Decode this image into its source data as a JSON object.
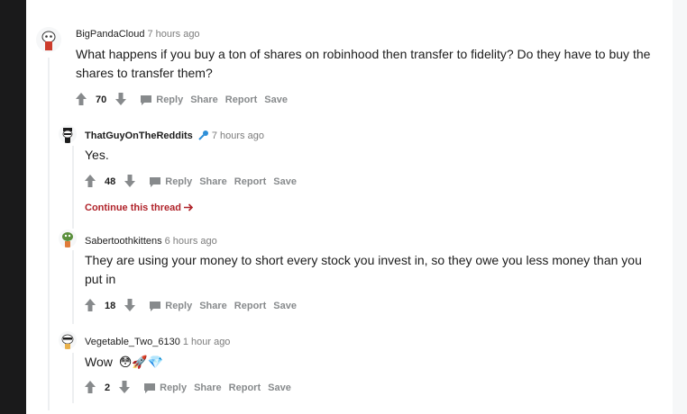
{
  "comments": [
    {
      "username": "BigPandaCloud",
      "time": "7 hours ago",
      "text": "What happens if you buy a ton of shares on robinhood then transfer to fidelity? Do they have to buy the shares to transfer them?",
      "score": "70",
      "avatar_color": "#cc3b2b"
    },
    {
      "username": "ThatGuyOnTheReddits",
      "time": "7 hours ago",
      "text": "Yes.",
      "score": "48",
      "flair_icon": "microphone-icon",
      "avatar_color": "#1c1c1c"
    },
    {
      "username": "Sabertoothkittens",
      "time": "6 hours ago",
      "text": "They are using your money to short every stock you invest in, so they owe you less money than you put in",
      "score": "18",
      "avatar_color": "#5a8f3c"
    },
    {
      "username": "Vegetable_Two_6130",
      "time": "1 hour ago",
      "text": "Wow",
      "emojis": "😳🚀💎",
      "score": "2",
      "avatar_color": "#e8b04a"
    }
  ],
  "actions": {
    "reply": "Reply",
    "share": "Share",
    "report": "Report",
    "save": "Save"
  },
  "continue_thread": "Continue this thread",
  "colors": {
    "accent": "#b0232a",
    "muted": "#878a8c",
    "text": "#1c1c1c"
  }
}
